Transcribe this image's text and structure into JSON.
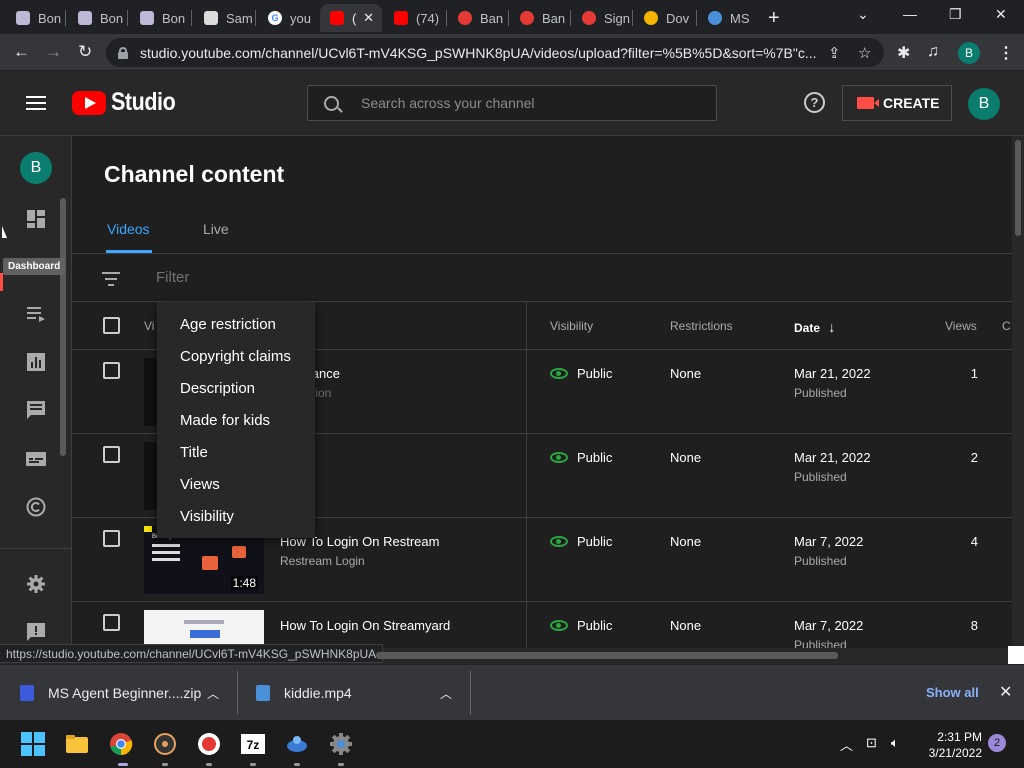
{
  "browser": {
    "tabs": [
      {
        "label": "Bon",
        "fav_color": "#bcb8d6"
      },
      {
        "label": "Bon",
        "fav_color": "#bcb8d6"
      },
      {
        "label": "Bon",
        "fav_color": "#bcb8d6"
      },
      {
        "label": "Sam",
        "fav_color": "#dcdcdc"
      },
      {
        "label": "you",
        "fav_color": "#ffffff"
      },
      {
        "label": "(",
        "fav_color": "#ff0000"
      },
      {
        "label": "(74)",
        "fav_color": "#ff0000"
      },
      {
        "label": "Ban",
        "fav_color": "#e53935"
      },
      {
        "label": "Ban",
        "fav_color": "#e53935"
      },
      {
        "label": "Sign",
        "fav_color": "#e53935"
      },
      {
        "label": "Dov",
        "fav_color": "#f4b400"
      },
      {
        "label": "MS",
        "fav_color": "#4a90d9"
      }
    ],
    "url": "studio.youtube.com/channel/UCvl6T-mV4KSG_pSWHNK8pUA/videos/upload?filter=%5B%5D&sort=%7B\"c...",
    "profile_initial": "B",
    "status_url": "https://studio.youtube.com/channel/UCvl6T-mV4KSG_pSWHNK8pUA"
  },
  "header": {
    "logo_text": "Studio",
    "search_placeholder": "Search across your channel",
    "help_glyph": "?",
    "create_label": "CREATE",
    "avatar_initial": "B"
  },
  "sidebar": {
    "avatar_initial": "B",
    "tooltip": "Dashboard"
  },
  "main": {
    "title": "Channel content",
    "tabs": [
      {
        "label": "Videos",
        "selected": true
      },
      {
        "label": "Live",
        "selected": false
      }
    ],
    "filter_placeholder": "Filter",
    "columns": {
      "video": "Vi",
      "visibility": "Visibility",
      "restrictions": "Restrictions",
      "date": "Date",
      "date_sort": "↓",
      "views": "Views",
      "more": "C"
    },
    "rows": [
      {
        "title": "troll dance",
        "description": "escription",
        "visibility": "Public",
        "restrictions": "None",
        "date": "Mar 21, 2022",
        "status": "Published",
        "views": "1",
        "duration": ""
      },
      {
        "title": "",
        "description": "",
        "visibility": "Public",
        "restrictions": "None",
        "date": "Mar 21, 2022",
        "status": "Published",
        "views": "2",
        "duration": ""
      },
      {
        "title": "How To Login On Restream",
        "description": "Restream Login",
        "visibility": "Public",
        "restrictions": "None",
        "date": "Mar 7, 2022",
        "status": "Published",
        "views": "4",
        "duration": "1:48",
        "thumb_text": "Boost your views"
      },
      {
        "title": "How To Login On Streamyard",
        "description": "",
        "visibility": "Public",
        "restrictions": "None",
        "date": "Mar 7, 2022",
        "status": "Published",
        "views": "8",
        "duration": ""
      }
    ]
  },
  "dropdown": {
    "items": [
      "Age restriction",
      "Copyright claims",
      "Description",
      "Made for kids",
      "Title",
      "Views",
      "Visibility"
    ]
  },
  "downloads": {
    "items": [
      {
        "name": "MS Agent Beginner....zip",
        "icon_color": "#3b5bdb"
      },
      {
        "name": "kiddie.mp4",
        "icon_color": "#4a90d9"
      }
    ],
    "show_all": "Show all"
  },
  "taskbar": {
    "time": "2:31 PM",
    "date": "3/21/2022",
    "notifications": "2"
  }
}
